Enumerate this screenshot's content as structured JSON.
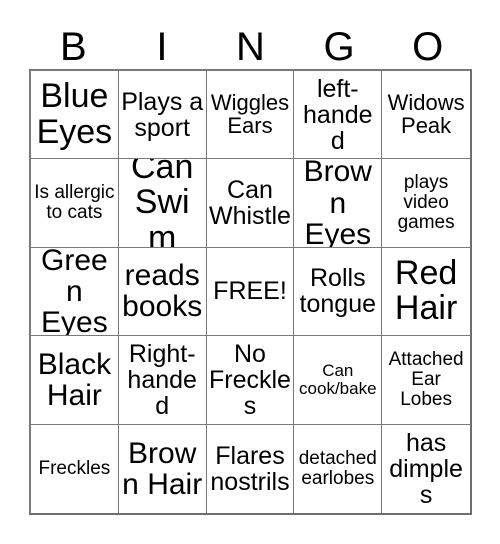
{
  "card": {
    "title": "BINGO",
    "headers": [
      "B",
      "I",
      "N",
      "G",
      "O"
    ],
    "free_space_label": "FREE!",
    "rows": [
      [
        {
          "text": "Blue Eyes",
          "size": "xl"
        },
        {
          "text": "Plays a sport",
          "size": "md"
        },
        {
          "text": "Wiggles Ears",
          "size": "sm"
        },
        {
          "text": "left-handed",
          "size": "md"
        },
        {
          "text": "Widows Peak",
          "size": "sm"
        }
      ],
      [
        {
          "text": "Is allergic to cats",
          "size": "xs"
        },
        {
          "text": "Can Swim",
          "size": "xl"
        },
        {
          "text": "Can Whistle",
          "size": "md"
        },
        {
          "text": "Brown Eyes",
          "size": "lg"
        },
        {
          "text": "plays video games",
          "size": "xs"
        }
      ],
      [
        {
          "text": "Green Eyes",
          "size": "lg"
        },
        {
          "text": "reads books",
          "size": "lg"
        },
        {
          "text": "FREE!",
          "size": "md"
        },
        {
          "text": "Rolls tongue",
          "size": "md"
        },
        {
          "text": "Red Hair",
          "size": "xl"
        }
      ],
      [
        {
          "text": "Black Hair",
          "size": "lg"
        },
        {
          "text": "Right-handed",
          "size": "md"
        },
        {
          "text": "No Freckles",
          "size": "md"
        },
        {
          "text": "Can cook/bake",
          "size": "xxs"
        },
        {
          "text": "Attached Ear Lobes",
          "size": "xs"
        }
      ],
      [
        {
          "text": "Freckles",
          "size": "xs"
        },
        {
          "text": "Brown Hair",
          "size": "lg"
        },
        {
          "text": "Flares nostrils",
          "size": "md"
        },
        {
          "text": "detached earlobes",
          "size": "xs"
        },
        {
          "text": "has dimples",
          "size": "md"
        }
      ]
    ]
  },
  "colors": {
    "background": "#ffffff",
    "text": "#000000",
    "grid_line": "#7a7a7a"
  }
}
